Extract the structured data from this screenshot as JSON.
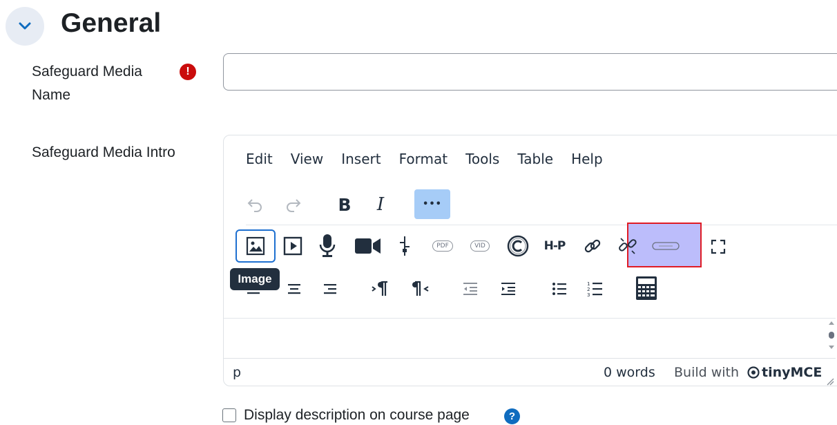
{
  "section": {
    "title": "General"
  },
  "fields": {
    "name_label": "Safeguard Media Name",
    "name_label_line1": "Safeguard Media",
    "name_label_line2": "Name",
    "name_value": "",
    "intro_label": "Safeguard Media Intro"
  },
  "editor": {
    "menu": [
      "Edit",
      "View",
      "Insert",
      "Format",
      "Tools",
      "Table",
      "Help"
    ],
    "toolbar_row1": [
      "undo-icon",
      "redo-icon",
      "bold-icon",
      "italic-icon",
      "more-icon"
    ],
    "bold_glyph": "B",
    "italic_glyph": "I",
    "more_glyph": "•••",
    "toolbar_row2": [
      "image-icon",
      "media-icon",
      "record-audio-icon",
      "record-video-icon",
      "equation-icon",
      "pdf-icon",
      "video-icon",
      "copyright-icon",
      "h5p-icon",
      "link-icon",
      "unlink-icon",
      "h5p-media-icon",
      "fullscreen-icon"
    ],
    "pdf_label": "PDF",
    "vid_label": "VID",
    "h5p_label": "H-P",
    "tooltip": "Image",
    "toolbar_row3": [
      "align-left-icon",
      "align-center-icon",
      "align-right-icon",
      "ltr-icon",
      "rtl-icon",
      "outdent-icon",
      "indent-icon",
      "bullet-list-icon",
      "numbered-list-icon",
      "calculator-icon"
    ],
    "status_path": "p",
    "word_count": "0 words",
    "build_with": "Build with",
    "brand": "tinyMCE",
    "highlight_color": "#bcbdfb"
  },
  "display_description": {
    "label": "Display description on course page",
    "checked": false
  }
}
